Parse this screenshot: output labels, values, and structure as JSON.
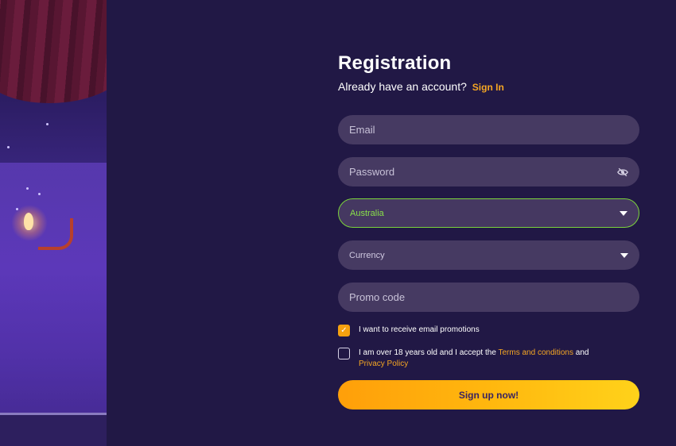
{
  "form": {
    "title": "Registration",
    "account_prompt": "Already have an account?",
    "sign_in_link": "Sign In",
    "email_placeholder": "Email",
    "password_placeholder": "Password",
    "country_value": "Australia",
    "currency_placeholder": "Currency",
    "promo_placeholder": "Promo code",
    "email_promo_label": "I want to receive email promotions",
    "email_promo_checked": true,
    "age_terms_prefix": "I am over 18 years old and I accept the",
    "terms_link": "Terms and conditions",
    "age_terms_and": "and",
    "privacy_link": "Privacy Policy",
    "age_terms_checked": false,
    "submit_label": "Sign up now!"
  },
  "icons": {
    "password_toggle": "eye-slash-icon",
    "dropdown": "caret-down-icon",
    "checked": "checkmark-icon"
  },
  "colors": {
    "background": "#211845",
    "field": "#463a62",
    "accent": "#f5a623",
    "valid": "#7bd33b"
  }
}
